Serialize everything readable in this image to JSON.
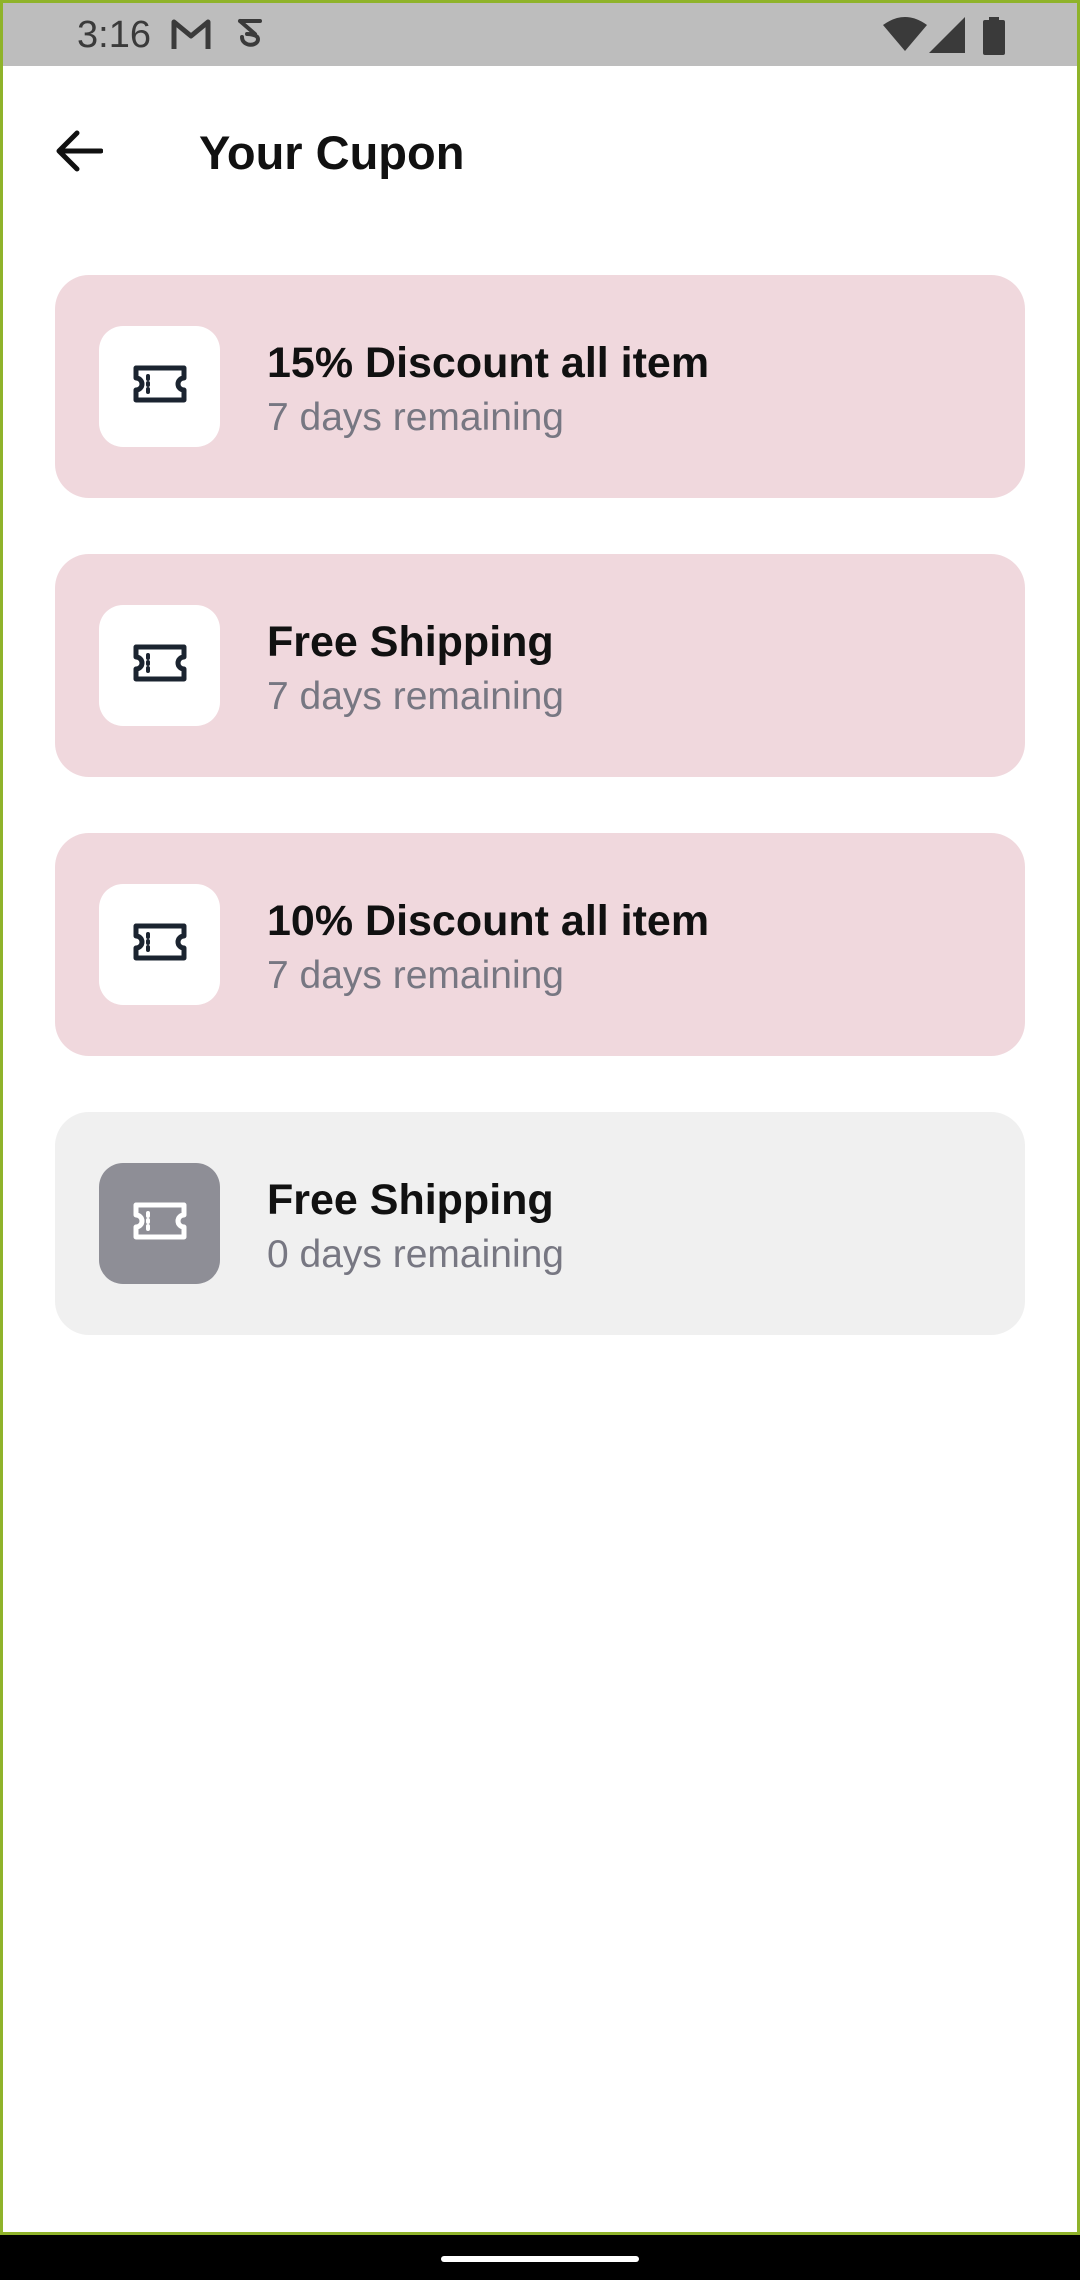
{
  "status_bar": {
    "time": "3:16",
    "icons": [
      "gmail-icon",
      "sync-icon",
      "wifi-icon",
      "signal-icon",
      "battery-icon"
    ]
  },
  "app_bar": {
    "back_icon": "arrow-left-icon",
    "title": "Your Cupon"
  },
  "coupons": [
    {
      "title": "15% Discount all item",
      "remaining": "7 days remaining",
      "state": "active",
      "icon": "ticket-icon"
    },
    {
      "title": "Free Shipping",
      "remaining": "7 days remaining",
      "state": "active",
      "icon": "ticket-icon"
    },
    {
      "title": "10% Discount all item",
      "remaining": "7 days remaining",
      "state": "active",
      "icon": "ticket-icon"
    },
    {
      "title": "Free Shipping",
      "remaining": "0 days remaining",
      "state": "expired",
      "icon": "ticket-icon"
    }
  ],
  "colors": {
    "active_card_bg": "#f0d8dd",
    "expired_card_bg": "#f0f0f0",
    "expired_icon_bg": "#8e8e96",
    "icon_dark": "#1b2430"
  }
}
